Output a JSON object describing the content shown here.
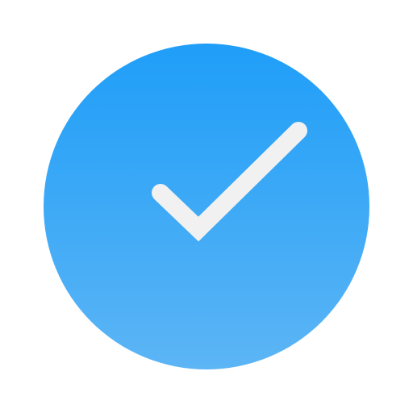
{
  "icon": {
    "name": "checkmark-circle-icon",
    "colors": {
      "gradient_top": "#1F9EF8",
      "gradient_bottom": "#5CB5F5",
      "check": "#F1F1F1",
      "background": "#FFFFFF"
    }
  }
}
